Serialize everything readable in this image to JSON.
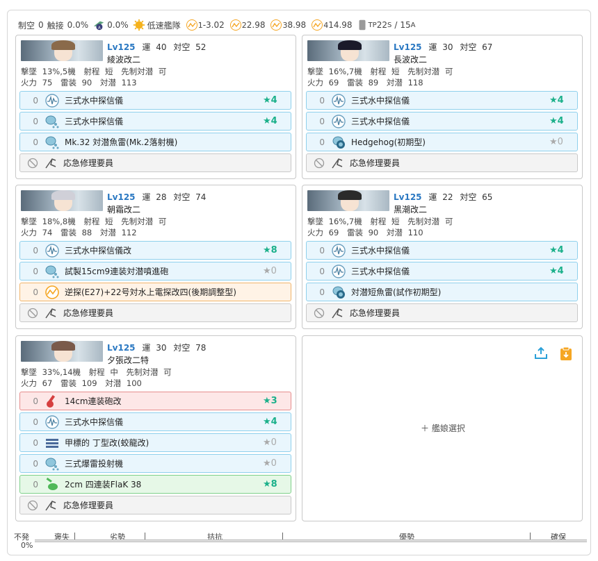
{
  "summary": {
    "air_label": "制空",
    "air_value": "0",
    "contact_label": "触接",
    "contact_value": "0.0%",
    "aa_value": "0.0%",
    "speed": "低速艦隊",
    "los1_value": "-3.02",
    "los2_value": "2.98",
    "los3_value": "8.98",
    "los4_value": "14.98",
    "los1_label": "1",
    "los2_label": "2",
    "los3_label": "3",
    "los4_label": "4",
    "tp_label": "TP",
    "tp_s": "22",
    "tp_s_sub": "S",
    "tp_sep": "/",
    "tp_a": "15",
    "tp_a_sub": "A"
  },
  "labels": {
    "luck": "運",
    "aa": "対空",
    "stat_sink": "撃墜",
    "range": "射程",
    "opening_asw": "先制対潜",
    "fire": "火力",
    "torpedo": "雷装",
    "asw": "対潜",
    "repair": "応急修理要員"
  },
  "ships": [
    {
      "lv": "Lv125",
      "luck": "40",
      "aa": "52",
      "name": "綾波改二",
      "sink": "13%,5機",
      "range": "短",
      "opening": "可",
      "fire": "75",
      "torpedo": "90",
      "asw": "113",
      "equips": [
        {
          "count": "0",
          "icon": "sonar-icon",
          "name": "三式水中探信儀",
          "star": "★4"
        },
        {
          "count": "0",
          "icon": "depth-charge-icon",
          "name": "三式水中探信儀",
          "star": "★4"
        },
        {
          "count": "0",
          "icon": "depth-charge-icon",
          "name": "Mk.32 対潜魚雷(Mk.2落射機)",
          "star": ""
        }
      ]
    },
    {
      "lv": "Lv125",
      "luck": "30",
      "aa": "67",
      "name": "長波改二",
      "sink": "16%,7機",
      "range": "短",
      "opening": "可",
      "fire": "69",
      "torpedo": "89",
      "asw": "118",
      "equips": [
        {
          "count": "0",
          "icon": "sonar-icon",
          "name": "三式水中探信儀",
          "star": "★4"
        },
        {
          "count": "0",
          "icon": "sonar-icon",
          "name": "三式水中探信儀",
          "star": "★4"
        },
        {
          "count": "0",
          "icon": "hedgehog-icon",
          "name": "Hedgehog(初期型)",
          "star": "★0"
        }
      ]
    },
    {
      "lv": "Lv125",
      "luck": "28",
      "aa": "74",
      "name": "朝霜改二",
      "sink": "18%,8機",
      "range": "短",
      "opening": "可",
      "fire": "74",
      "torpedo": "88",
      "asw": "112",
      "equips": [
        {
          "count": "0",
          "icon": "sonar-icon",
          "name": "三式水中探信儀改",
          "star": "★8"
        },
        {
          "count": "0",
          "icon": "depth-charge-icon",
          "name": "試製15cm9連装対潜噴進砲",
          "star": "★0"
        },
        {
          "count": "0",
          "icon": "radar-icon",
          "name": "逆探(E27)+22号対水上電探改四(後期調整型)",
          "star": ""
        }
      ]
    },
    {
      "lv": "Lv125",
      "luck": "22",
      "aa": "65",
      "name": "黒潮改二",
      "sink": "16%,7機",
      "range": "短",
      "opening": "可",
      "fire": "69",
      "torpedo": "90",
      "asw": "110",
      "equips": [
        {
          "count": "0",
          "icon": "sonar-icon",
          "name": "三式水中探信儀",
          "star": "★4"
        },
        {
          "count": "0",
          "icon": "sonar-icon",
          "name": "三式水中探信儀",
          "star": "★4"
        },
        {
          "count": "0",
          "icon": "hedgehog-icon",
          "name": "対潜短魚雷(試作初期型)",
          "star": ""
        }
      ]
    },
    {
      "lv": "Lv125",
      "luck": "30",
      "aa": "78",
      "name": "夕張改二特",
      "sink": "33%,14機",
      "range": "中",
      "opening": "可",
      "fire": "67",
      "torpedo": "109",
      "asw": "100",
      "equips": [
        {
          "count": "0",
          "icon": "gun-icon",
          "name": "14cm連装砲改",
          "star": "★3"
        },
        {
          "count": "0",
          "icon": "sonar-icon",
          "name": "三式水中探信儀",
          "star": "★4"
        },
        {
          "count": "0",
          "icon": "midget-sub-icon",
          "name": "甲標的 丁型改(蛟龍改)",
          "star": "★0"
        },
        {
          "count": "0",
          "icon": "depth-charge-icon",
          "name": "三式爆雷投射機",
          "star": "★0"
        },
        {
          "count": "0",
          "icon": "aa-gun-icon",
          "name": "2cm 四連装FlaK 38",
          "star": "★8"
        }
      ]
    }
  ],
  "right_pane": {
    "select_label": "＋ 艦娘選択"
  },
  "gauge": {
    "labels": [
      "不発",
      "褒失",
      "劣勢",
      "拮抗",
      "優勢",
      "確保"
    ],
    "pct": "0%"
  },
  "colors": {
    "accent": "#2a78c2",
    "star": "#1bb08a",
    "orange": "#f5a623"
  }
}
